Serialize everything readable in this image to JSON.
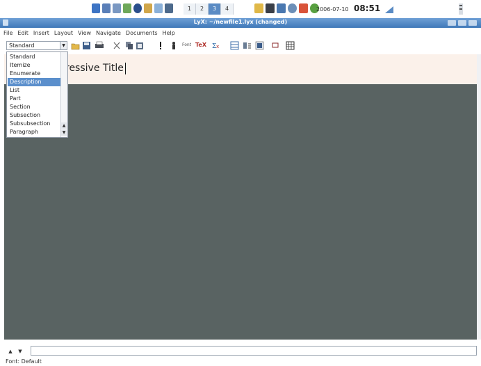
{
  "panel": {
    "workspaces": [
      "1",
      "2",
      "3",
      "4"
    ],
    "active_workspace": "3",
    "date": "2006-07-10",
    "time": "08:51"
  },
  "window": {
    "title": "LyX: ~/newfile1.lyx (changed)"
  },
  "menubar": [
    "File",
    "Edit",
    "Insert",
    "Layout",
    "View",
    "Navigate",
    "Documents",
    "Help"
  ],
  "toolbar": {
    "layout_value": "Standard",
    "icons": [
      "open-icon",
      "save-icon",
      "print-icon",
      "cut-icon",
      "copy-icon",
      "paste-icon",
      "emphasis-icon",
      "noun-icon",
      "font-icon",
      "tex-icon",
      "math-icon",
      "table-icon",
      "figure-icon",
      "float-icon",
      "insert-table-icon"
    ],
    "font_label": "Font",
    "tex_label": "TeX"
  },
  "layout_dropdown": {
    "items": [
      "Standard",
      "Itemize",
      "Enumerate",
      "Description",
      "List",
      "Part",
      "Section",
      "Subsection",
      "Subsubsection",
      "Paragraph"
    ],
    "selected": "Description"
  },
  "document": {
    "title_text": "ressive Title"
  },
  "statusbar": {
    "text": "Font: Default"
  },
  "colors": {
    "workspace": "#596362",
    "selection": "#5b8fcc",
    "titlebar": "#3f78b8",
    "header_bg": "#fbf1ea"
  }
}
